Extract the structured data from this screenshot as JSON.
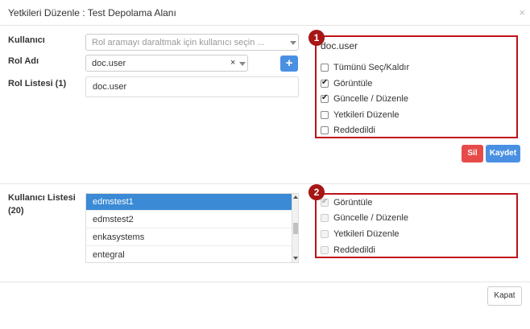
{
  "header": {
    "title": "Yetkileri Düzenle : Test Depolama Alanı",
    "close_glyph": "×"
  },
  "form": {
    "user_label": "Kullanıcı",
    "user_placeholder": "Rol aramayı daraltmak için kullanıcı seçin ...",
    "role_label": "Rol Adı",
    "role_value": "doc.user",
    "clear_glyph": "×",
    "add_glyph": "+",
    "role_list_label": "Rol Listesi (1)",
    "role_list": [
      "doc.user"
    ]
  },
  "role_panel": {
    "badge": "1",
    "title": "doc.user",
    "options": [
      {
        "label": "Tümünü Seç/Kaldır",
        "checked": false
      },
      {
        "label": "Görüntüle",
        "checked": true
      },
      {
        "label": "Güncelle / Düzenle",
        "checked": true
      },
      {
        "label": "Yetkileri Düzenle",
        "checked": false
      },
      {
        "label": "Reddedildi",
        "checked": false
      }
    ]
  },
  "actions": {
    "delete_label": "Sil",
    "save_label": "Kaydet"
  },
  "users": {
    "label": "Kullanıcı Listesi (20)",
    "items": [
      "edmstest1",
      "edmstest2",
      "enkasystems",
      "entegral"
    ],
    "selected_index": 0
  },
  "user_panel": {
    "badge": "2",
    "options": [
      {
        "label": "Görüntüle",
        "checked": true
      },
      {
        "label": "Güncelle / Düzenle",
        "checked": false
      },
      {
        "label": "Yetkileri Düzenle",
        "checked": false
      },
      {
        "label": "Reddedildi",
        "checked": false
      }
    ]
  },
  "footer": {
    "close_label": "Kapat"
  },
  "colors": {
    "accent": "#4a90e2",
    "danger": "#e84a4a",
    "highlight": "#c0111a",
    "selected_row": "#3a8ad6"
  }
}
